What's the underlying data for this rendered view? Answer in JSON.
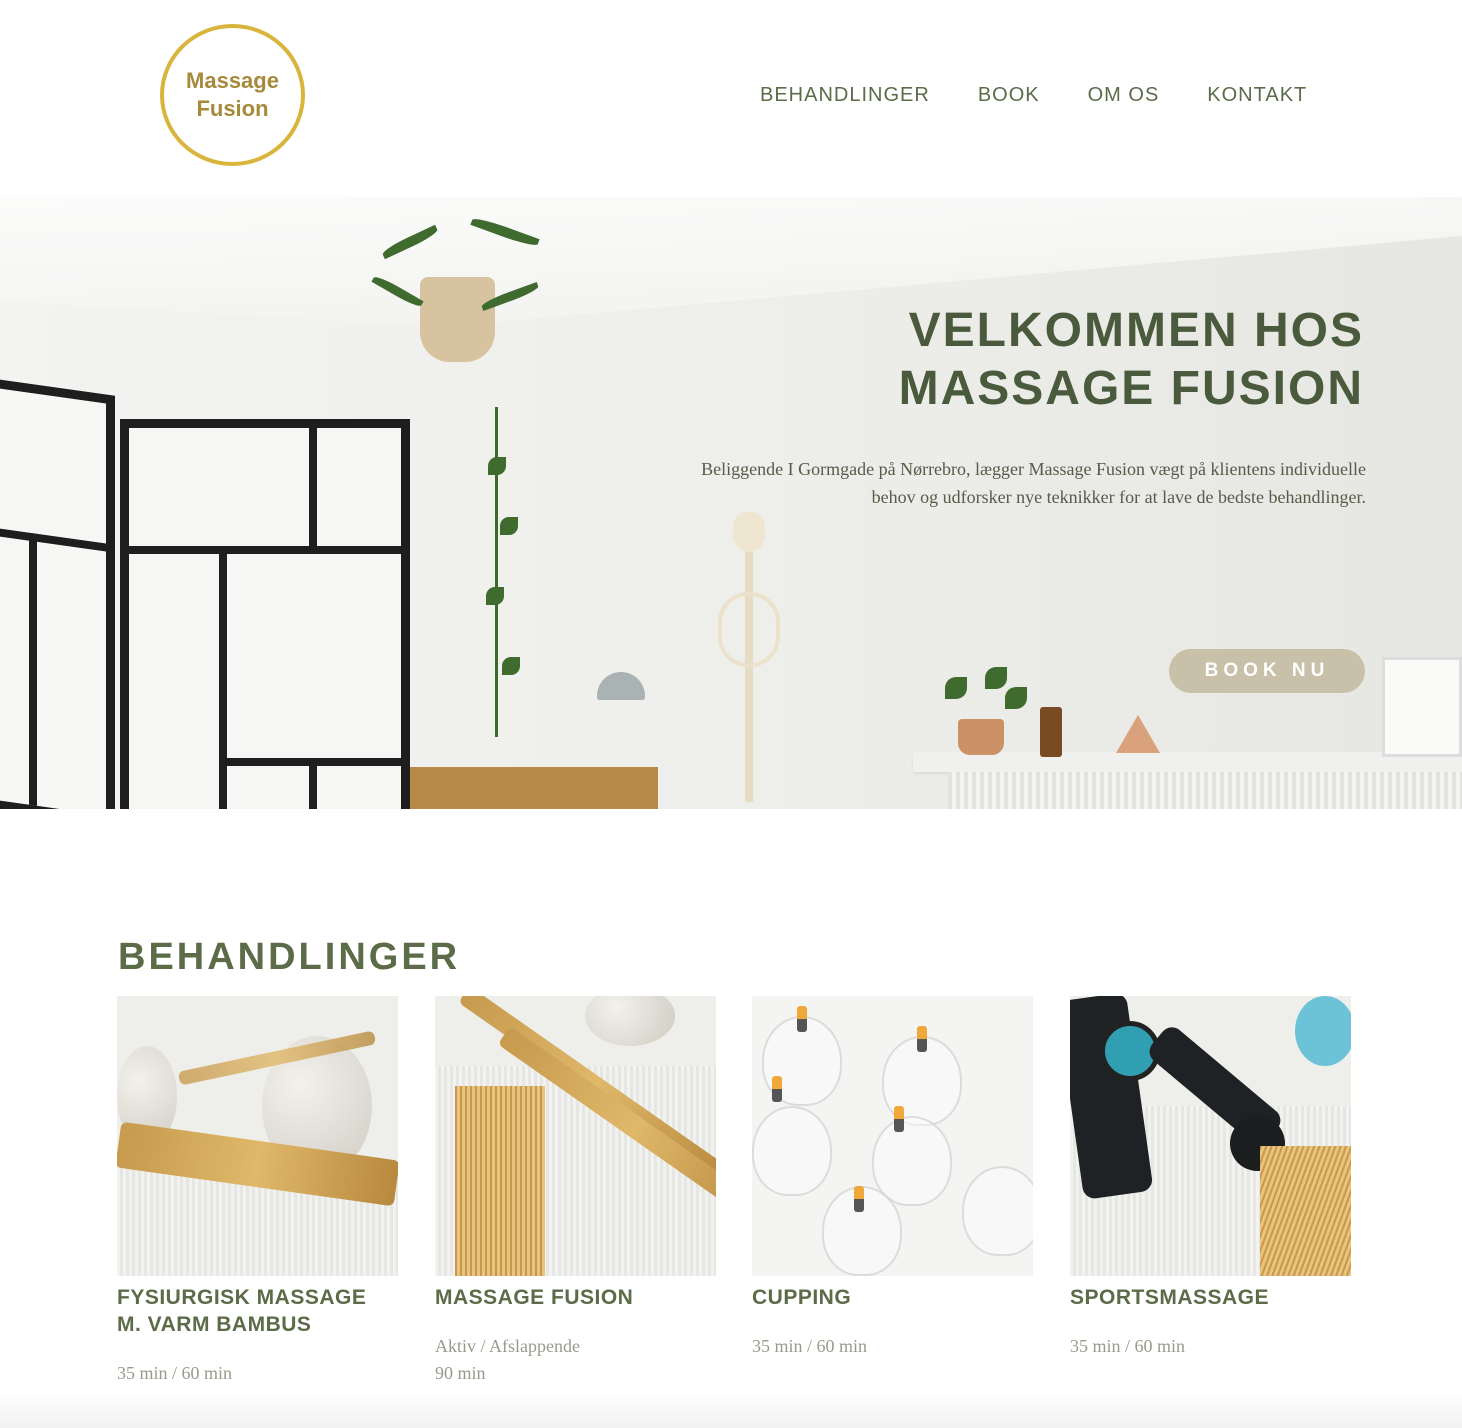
{
  "brand": {
    "logo_line1": "Massage",
    "logo_line2": "Fusion"
  },
  "nav": [
    "BEHANDLINGER",
    "BOOK",
    "OM OS",
    "KONTAKT"
  ],
  "hero": {
    "title_line1": "VELKOMMEN HOS",
    "title_line2": "MASSAGE FUSION",
    "subtitle_line1": "Beliggende I Gormgade på Nørrebro, lægger Massage Fusion vægt på klientens individuelle",
    "subtitle_line2": "behov og udforsker nye teknikker for at lave de bedste behandlinger.",
    "cta": "BOOK NU"
  },
  "treatments": {
    "title": "BEHANDLINGER",
    "items": [
      {
        "name_line1": "FYSIURGISK MASSAGE",
        "name_line2": "M. VARM BAMBUS",
        "meta_line1": "35 min / 60 min",
        "meta_line2": ""
      },
      {
        "name_line1": "MASSAGE FUSION",
        "name_line2": "",
        "meta_line1": "Aktiv / Afslappende",
        "meta_line2": "90 min"
      },
      {
        "name_line1": "CUPPING",
        "name_line2": "",
        "meta_line1": "35 min / 60 min",
        "meta_line2": ""
      },
      {
        "name_line1": "SPORTSMASSAGE",
        "name_line2": "",
        "meta_line1": "35 min / 60 min",
        "meta_line2": ""
      }
    ]
  },
  "colors": {
    "primary": "#5c6b48",
    "gold": "#d9b53c",
    "button": "#c8c0a8"
  }
}
